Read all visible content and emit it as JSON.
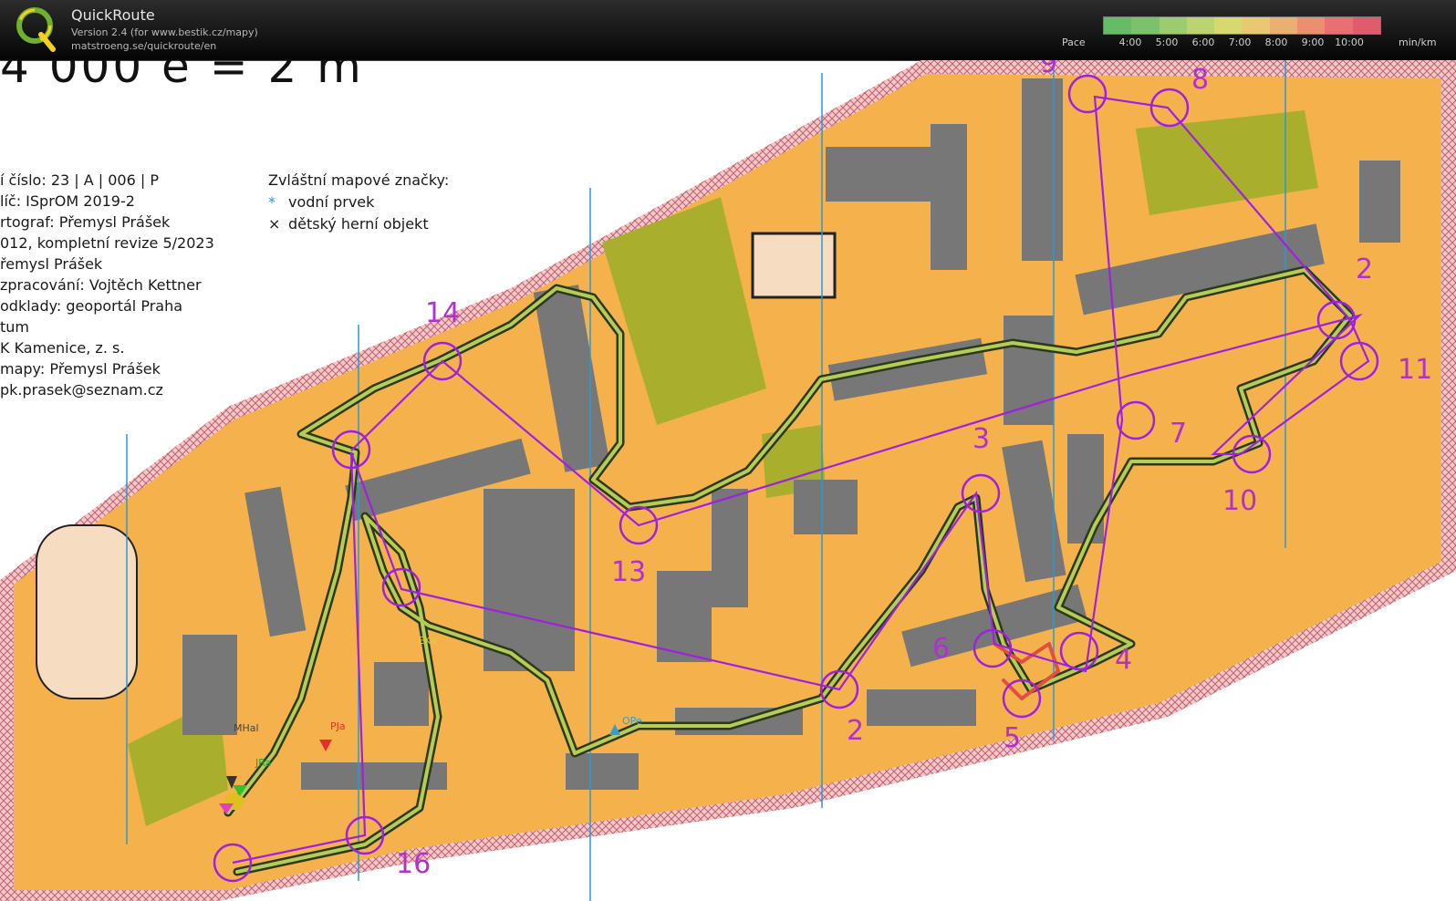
{
  "app": {
    "title": "QuickRoute",
    "version": "Version 2.4  (for www.bestik.cz/mapy)",
    "url": "matstroeng.se/quickroute/en",
    "logo_letter": "Q"
  },
  "pace_scale": {
    "label": "Pace",
    "ticks": [
      "4:00",
      "5:00",
      "6:00",
      "7:00",
      "8:00",
      "9:00",
      "10:00"
    ],
    "unit": "min/km",
    "colors": [
      "#66bb66",
      "#7cc26a",
      "#9ccc70",
      "#bcd470",
      "#d8d870",
      "#e8c870",
      "#eab070",
      "#ea9070",
      "#e87070",
      "#e05c6c"
    ]
  },
  "map_text": {
    "scale_text": "4 000   e = 2 m",
    "legend_lines": [
      "í číslo: 23 | A | 006 | P",
      "líč: ISprOM 2019-2",
      "rtograf: Přemysl Prášek",
      "012, kompletní revize 5/2023",
      "řemysl Prášek",
      "zpracování: Vojtěch Kettner",
      "odklady: geoportál Praha",
      "tum",
      "K Kamenice, z. s.",
      "mapy: Přemysl Prášek",
      "pk.prasek@seznam.cz"
    ],
    "special_title": "Zvláštní mapové značky:",
    "special_items": [
      {
        "symbol": "*",
        "label": "vodní prvek"
      },
      {
        "symbol": "×",
        "label": "dětský herní objekt"
      }
    ]
  },
  "controls": [
    {
      "num": "2"
    },
    {
      "num": "3"
    },
    {
      "num": "4"
    },
    {
      "num": "5"
    },
    {
      "num": "6"
    },
    {
      "num": "7"
    },
    {
      "num": "8"
    },
    {
      "num": "9"
    },
    {
      "num": "10"
    },
    {
      "num": "11"
    },
    {
      "num": "13"
    },
    {
      "num": "14"
    },
    {
      "num": "16"
    },
    {
      "num": "2"
    }
  ],
  "runners": [
    "EKa",
    "PJa",
    "OPe",
    "MHal",
    "JRa"
  ],
  "colors": {
    "course": "#a020e0",
    "route_dark": "#2a3a1a",
    "route_light": "#d8e060",
    "road_pattern": "#d08088",
    "open_land": "#f5b04a",
    "building": "#7a7a7a",
    "forest": "#a8ad2a"
  }
}
